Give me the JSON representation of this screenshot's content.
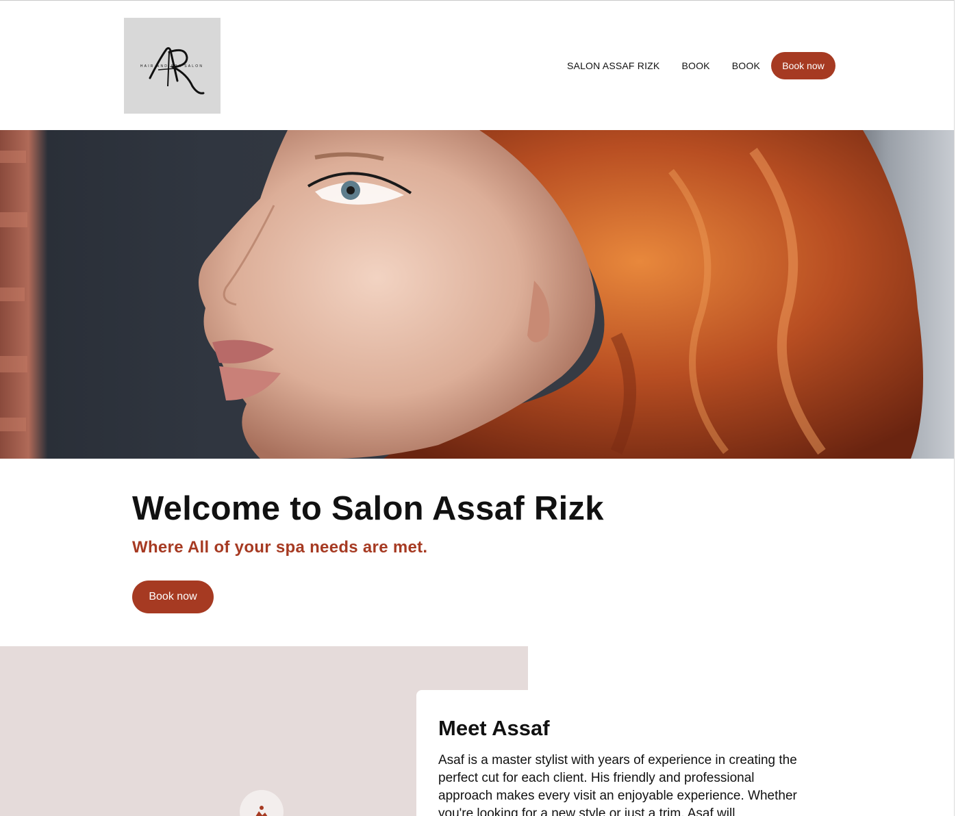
{
  "header": {
    "logo": {
      "monogram": "AR",
      "tagline": "HAIR AND SPA SALON"
    },
    "nav": {
      "items": [
        {
          "label": "SALON ASSAF RIZK"
        },
        {
          "label": "BOOK"
        },
        {
          "label": "BOOK"
        }
      ],
      "cta_label": "Book now"
    }
  },
  "hero": {
    "image": "portrait-photo-red-hair"
  },
  "welcome": {
    "title": "Welcome to Salon Assaf Rizk",
    "subtitle": "Where All of your spa needs are met.",
    "cta_label": "Book now"
  },
  "meet": {
    "image_icon": "image-placeholder-icon",
    "title": "Meet Assaf",
    "body": "Asaf is a master stylist with years of experience in creating the perfect cut for each client. His friendly and professional approach makes every visit an enjoyable experience. Whether you're looking for a new style or just a trim, Asaf will"
  },
  "colors": {
    "accent": "#a63a22",
    "panel": "#e5dbda",
    "logo_bg": "#d8d8d8"
  }
}
